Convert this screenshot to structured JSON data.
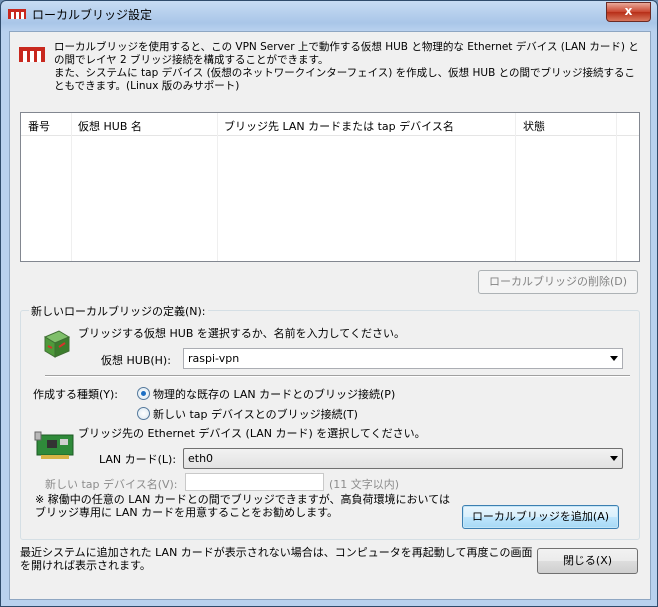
{
  "window": {
    "title": "ローカルブリッジ設定",
    "close_glyph": "x"
  },
  "description": "ローカルブリッジを使用すると、この VPN Server 上で動作する仮想 HUB と物理的な Ethernet デバイス (LAN カード) との間でレイヤ 2 ブリッジ接続を構成することができます。\nまた、システムに tap デバイス (仮想のネットワークインターフェイス) を作成し、仮想 HUB との間でブリッジ接続することもできます。(Linux 版のみサポート)",
  "bridge_list": {
    "columns": [
      "番号",
      "仮想 HUB 名",
      "ブリッジ先 LAN カードまたは tap デバイス名",
      "状態"
    ],
    "rows": []
  },
  "delete_button": "ローカルブリッジの削除(D)",
  "new_bridge": {
    "legend": "新しいローカルブリッジの定義(N):",
    "hub_prompt": "ブリッジする仮想 HUB を選択するか、名前を入力してください。",
    "hub_label": "仮想 HUB(H):",
    "hub_value": "raspi-vpn",
    "type_label": "作成する種類(Y):",
    "radio_physical": "物理的な既存の LAN カードとのブリッジ接続(P)",
    "radio_tap": "新しい tap デバイスとのブリッジ接続(T)",
    "radio_selected": "physical",
    "lan_prompt": "ブリッジ先の Ethernet デバイス (LAN カード) を選択してください。",
    "lan_label": "LAN カード(L):",
    "lan_value": "eth0",
    "tap_label": "新しい tap デバイス名(V):",
    "tap_value": "",
    "tap_hint": "(11 文字以内)",
    "note": "※ 稼働中の任意の LAN カードとの間でブリッジできますが、高負荷環境においてはブリッジ専用に LAN カードを用意することをお勧めします。",
    "add_button": "ローカルブリッジを追加(A)"
  },
  "footer": {
    "note": "最近システムに追加された LAN カードが表示されない場合は、コンピュータを再起動して再度この画面を開ければ表示されます。",
    "close_button": "閉じる(X)"
  },
  "icons": {
    "title": "softether-logo-icon",
    "header": "bridge-logo-icon",
    "hub": "virtual-hub-icon",
    "lan": "network-card-icon"
  },
  "colors": {
    "close_button": "#c9452f",
    "focus_button": "#3c7fb1"
  }
}
